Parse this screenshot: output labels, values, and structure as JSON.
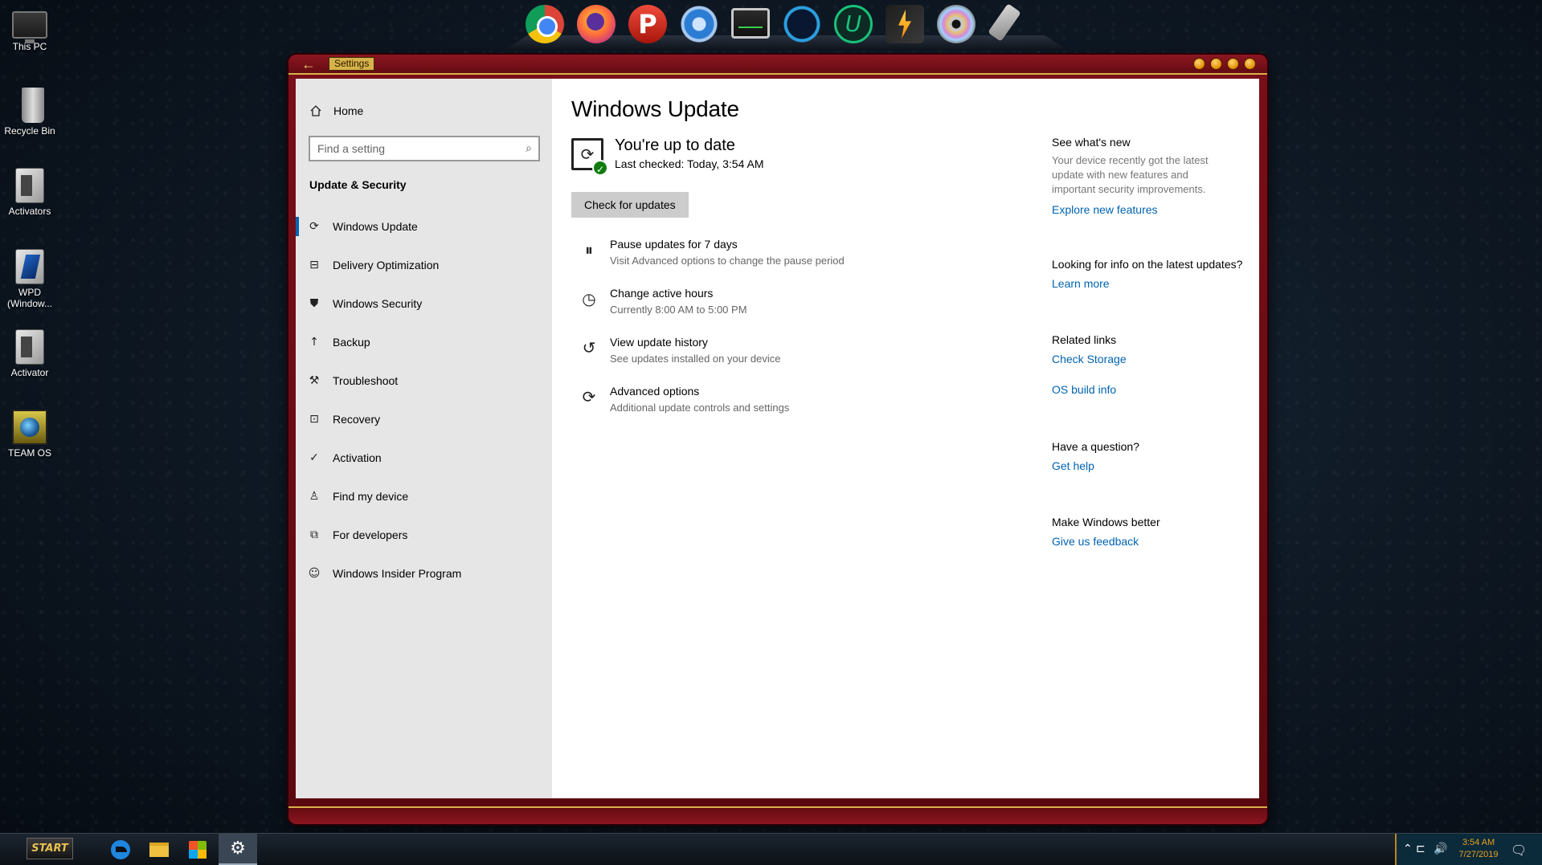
{
  "desktop": {
    "icons": [
      {
        "label": "This PC",
        "icon": "computer-icon"
      },
      {
        "label": "Recycle Bin",
        "icon": "recycle-bin-icon"
      },
      {
        "label": "Activators",
        "icon": "folder-icon"
      },
      {
        "label": "WPD (Window...",
        "icon": "wpd-icon"
      },
      {
        "label": "Activator",
        "icon": "folder-icon"
      },
      {
        "label": "TEAM OS",
        "icon": "team-os-icon"
      }
    ]
  },
  "dock": {
    "items": [
      "chrome-icon",
      "firefox-icon",
      "psiphon-icon",
      "settings-gear-icon",
      "system-monitor-icon",
      "dots-app-icon",
      "u-app-icon",
      "bolt-app-icon",
      "disc-icon",
      "usb-drive-icon"
    ],
    "psiphon_letter": "P",
    "u_letter": "U"
  },
  "window": {
    "title": "Settings",
    "back_glyph": "←"
  },
  "sidebar": {
    "home_label": "Home",
    "search_placeholder": "Find a setting",
    "section_title": "Update & Security",
    "items": [
      {
        "label": "Windows Update",
        "icon": "refresh-icon",
        "glyph": "⟳",
        "active": true
      },
      {
        "label": "Delivery Optimization",
        "icon": "delivery-optimization-icon",
        "glyph": "⊟",
        "active": false
      },
      {
        "label": "Windows Security",
        "icon": "shield-icon",
        "glyph": "⛊",
        "active": false
      },
      {
        "label": "Backup",
        "icon": "backup-arrow-icon",
        "glyph": "↑",
        "active": false
      },
      {
        "label": "Troubleshoot",
        "icon": "wrench-icon",
        "glyph": "⚒",
        "active": false
      },
      {
        "label": "Recovery",
        "icon": "recovery-icon",
        "glyph": "⊡",
        "active": false
      },
      {
        "label": "Activation",
        "icon": "check-circle-icon",
        "glyph": "✓",
        "active": false
      },
      {
        "label": "Find my device",
        "icon": "person-location-icon",
        "glyph": "♙",
        "active": false
      },
      {
        "label": "For developers",
        "icon": "developer-tools-icon",
        "glyph": "⧉",
        "active": false
      },
      {
        "label": "Windows Insider Program",
        "icon": "insider-cat-icon",
        "glyph": "☺",
        "active": false
      }
    ]
  },
  "main": {
    "title": "Windows Update",
    "status_headline": "You're up to date",
    "status_sub": "Last checked: Today, 3:54 AM",
    "check_button": "Check for updates",
    "options": [
      {
        "title": "Pause updates for 7 days",
        "subtitle": "Visit Advanced options to change the pause period",
        "icon": "pause-icon",
        "glyph": "⏸"
      },
      {
        "title": "Change active hours",
        "subtitle": "Currently 8:00 AM to 5:00 PM",
        "icon": "clock-icon",
        "glyph": "◷"
      },
      {
        "title": "View update history",
        "subtitle": "See updates installed on your device",
        "icon": "history-icon",
        "glyph": "↺"
      },
      {
        "title": "Advanced options",
        "subtitle": "Additional update controls and settings",
        "icon": "advanced-sync-icon",
        "glyph": "⟳"
      }
    ]
  },
  "rail": {
    "whats_new": {
      "heading": "See what's new",
      "body": "Your device recently got the latest update with new features and important security improvements.",
      "link": "Explore new features"
    },
    "latest": {
      "heading": "Looking for info on the latest updates?",
      "link": "Learn more"
    },
    "related": {
      "heading": "Related links",
      "link1": "Check Storage",
      "link2": "OS build info"
    },
    "question": {
      "heading": "Have a question?",
      "link": "Get help"
    },
    "feedback": {
      "heading": "Make Windows better",
      "link": "Give us feedback"
    }
  },
  "taskbar": {
    "start_label": "START",
    "apps": [
      "edge-icon",
      "file-explorer-icon",
      "store-icon",
      "settings-gear-icon"
    ],
    "settings_glyph": "⚙",
    "tray": {
      "chevron": "⌃",
      "network_glyph": "⊏",
      "volume_glyph": "🔊",
      "time": "3:54 AM",
      "date": "7/27/2019",
      "notifications_glyph": "🗨"
    }
  },
  "colors": {
    "accent": "#0063b1",
    "frame": "#7a0f18",
    "frame_trim": "#d8b24a",
    "success": "#107c10",
    "clock": "#e8a020"
  }
}
